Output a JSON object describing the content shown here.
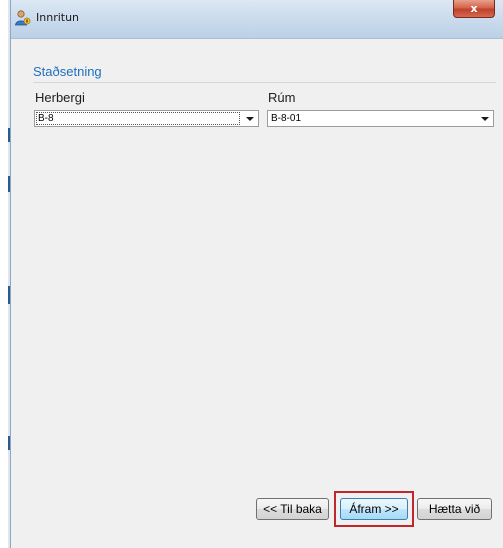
{
  "window": {
    "title": "Innritun",
    "close_label": "x"
  },
  "section": {
    "title": "Staðsetning"
  },
  "fields": {
    "herbergi": {
      "label": "Herbergi",
      "value": "B-8"
    },
    "rum": {
      "label": "Rúm",
      "value": "B-8-01"
    }
  },
  "buttons": {
    "back": "<< Til baka",
    "next": "Áfram >>",
    "cancel": "Hætta við"
  },
  "colors": {
    "accent": "#1f6fbd",
    "highlight": "#c0262d"
  }
}
